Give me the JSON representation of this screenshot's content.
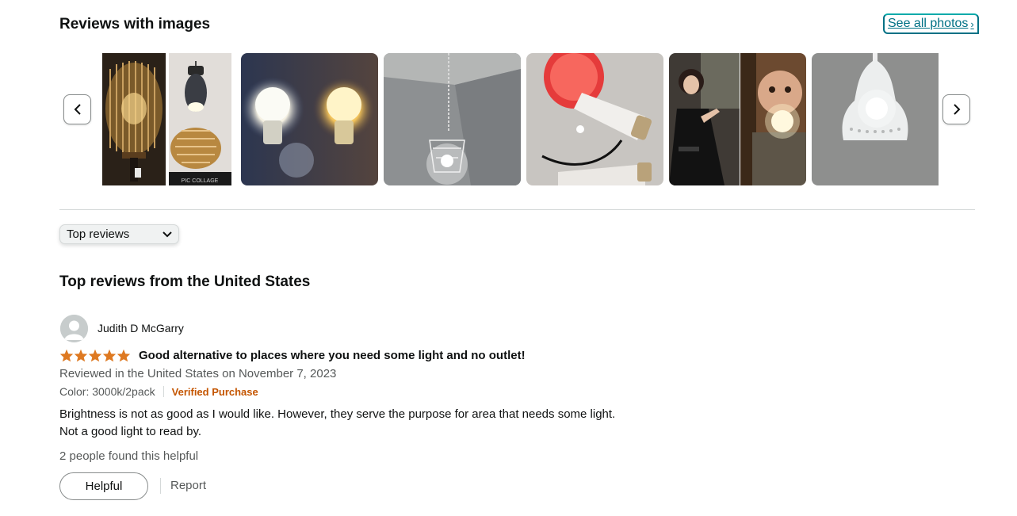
{
  "gallery": {
    "title": "Reviews with images",
    "see_all_label": "See all photos",
    "see_all_chevron": "›",
    "prev_icon": "chevron-left-icon",
    "next_icon": "chevron-right-icon",
    "photo_watermark": "PIC COLLAGE"
  },
  "sort": {
    "selected": "Top reviews"
  },
  "reviews_heading": "Top reviews from the United States",
  "review": {
    "author": "Judith D McGarry",
    "rating": 5,
    "title": "Good alternative to places where you need some light and no outlet!",
    "date_line": "Reviewed in the United States on November 7, 2023",
    "variant": "Color: 3000k/2pack",
    "verified_label": "Verified Purchase",
    "body_line1": "Brightness is not as good as I would like. However, they serve the purpose for area that needs some light.",
    "body_line2": "Not a good light to read by.",
    "helpful_count": "2 people found this helpful",
    "helpful_button": "Helpful",
    "report_label": "Report"
  },
  "colors": {
    "link": "#007185",
    "star": "#de7921",
    "verified": "#c45500",
    "muted_text": "#565959"
  }
}
